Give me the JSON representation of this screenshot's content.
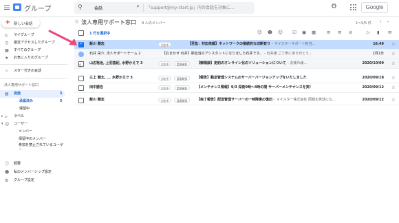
{
  "appbar": {
    "title": "グループ",
    "search_scope": "会話",
    "search_placeholder": "「support@my-start.jp」内の会話を対象に...",
    "account_button": "Google"
  },
  "sidebar": {
    "new_conversation": "新しい会話",
    "items": [
      {
        "label": "マイグループ",
        "icon": "home-icon"
      },
      {
        "label": "最近アクセスしたグループ",
        "icon": "clock-icon"
      },
      {
        "label": "すべてのグループ",
        "icon": "grid-icon"
      },
      {
        "label": "お気に入りのグループ",
        "icon": "star-folder-icon"
      },
      {
        "label": "スター付きの会話",
        "icon": "star-icon"
      }
    ],
    "group_section": "法人専用サポート窓口",
    "group_items": [
      {
        "label": "会話",
        "count": "5",
        "icon": "chat-icon"
      },
      {
        "label": "承認済み",
        "count": "5"
      },
      {
        "label": "保留中"
      },
      {
        "label": "ラベル",
        "icon": "label-icon"
      },
      {
        "label": "ユーザー",
        "icon": "people-icon"
      },
      {
        "label": "メンバー"
      },
      {
        "label": "保留中のメンバー"
      },
      {
        "label": "参加を禁止されているユーザー"
      },
      {
        "label": "概要",
        "icon": "info-icon"
      },
      {
        "label": "私のメンバーシップ設定",
        "icon": "person-icon"
      },
      {
        "label": "グループ設定",
        "icon": "gear-icon"
      }
    ]
  },
  "header": {
    "title": "法人専用サポート窓口",
    "members": "9 人のメンバー",
    "pager": "1～5/5 件",
    "selection_info": "1 行を選択中"
  },
  "rows": [
    {
      "sender": "飯川 剛志",
      "tag": "対応中",
      "subject": "【至急：対応依頼】ネットワークの接続的な切断有り",
      "preview": " – マイスターサポート担当...",
      "date": "16:49",
      "selected": true,
      "unread": true
    },
    {
      "sender": "石井 栄介, 法人サポートチーム 2",
      "subject": "【おまかせ 石井】新担当のアシスタントになりました石井です。",
      "preview": " – 石井様 ご丁寧にありがとう...",
      "date": "2月1日",
      "selected": false,
      "unread": false
    },
    {
      "sender": "山辺裕治, 上羽直紀, 水野かえで 3",
      "tag": "対応中",
      "tag2": "重要確保",
      "subject": "【御相談】定約のオンライン化のソリューションについて",
      "preview": " – お疲れ様...",
      "date": "2020/10/09",
      "selected": false,
      "unread": true
    },
    {
      "sender": "三上 健太, ... 水野かえで 3",
      "tag": "対応中",
      "tag2": "重要確保",
      "subject": "【報告】勤怠管理システムのサーバーバージョンアップをいたしました",
      "preview": "",
      "date": "2020/09/18",
      "selected": false,
      "unread": true
    },
    {
      "sender": "田中勝吾",
      "tag": "対応中",
      "tag2": "重要確保",
      "subject": "【メンテナンス情報】9/3 深夜0時～4時の間 サーバーメンテナンスを実!",
      "preview": "",
      "date": "2020/09/12",
      "selected": false,
      "unread": true
    },
    {
      "sender": "飯川 剛志",
      "tag": "対応中",
      "tag2": "重要確保",
      "subject": "【完了報告】配送管理サーバーの一時障害の復旧",
      "preview": " – マイスター株式会社 岡様お世話にな...",
      "date": "2020/09/12",
      "selected": false,
      "unread": true
    }
  ],
  "colors": {
    "accent": "#1a73e8",
    "selected_row": "#c2dbff",
    "arrow": "#e84a7b"
  }
}
